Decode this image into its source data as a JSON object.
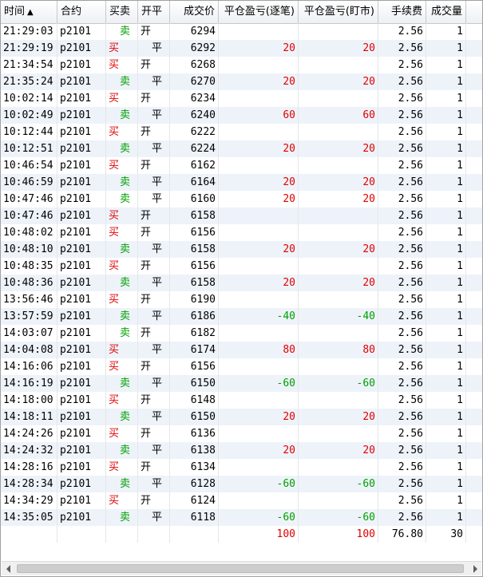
{
  "columns": [
    "时间",
    "合约",
    "买卖",
    "开平",
    "成交价",
    "平仓盈亏(逐笔)",
    "平仓盈亏(盯市)",
    "手续费",
    "成交量"
  ],
  "sort_indicator": "▲",
  "rows": [
    {
      "time": "21:29:03",
      "contract": "p2101",
      "side": "卖",
      "oc": "开",
      "price": "6294",
      "pnl1": "",
      "pnl2": "",
      "fee": "2.56",
      "qty": "1"
    },
    {
      "time": "21:29:19",
      "contract": "p2101",
      "side": "买",
      "oc": "平",
      "price": "6292",
      "pnl1": "20",
      "pnl2": "20",
      "fee": "2.56",
      "qty": "1"
    },
    {
      "time": "21:34:54",
      "contract": "p2101",
      "side": "买",
      "oc": "开",
      "price": "6268",
      "pnl1": "",
      "pnl2": "",
      "fee": "2.56",
      "qty": "1"
    },
    {
      "time": "21:35:24",
      "contract": "p2101",
      "side": "卖",
      "oc": "平",
      "price": "6270",
      "pnl1": "20",
      "pnl2": "20",
      "fee": "2.56",
      "qty": "1"
    },
    {
      "time": "10:02:14",
      "contract": "p2101",
      "side": "买",
      "oc": "开",
      "price": "6234",
      "pnl1": "",
      "pnl2": "",
      "fee": "2.56",
      "qty": "1"
    },
    {
      "time": "10:02:49",
      "contract": "p2101",
      "side": "卖",
      "oc": "平",
      "price": "6240",
      "pnl1": "60",
      "pnl2": "60",
      "fee": "2.56",
      "qty": "1"
    },
    {
      "time": "10:12:44",
      "contract": "p2101",
      "side": "买",
      "oc": "开",
      "price": "6222",
      "pnl1": "",
      "pnl2": "",
      "fee": "2.56",
      "qty": "1"
    },
    {
      "time": "10:12:51",
      "contract": "p2101",
      "side": "卖",
      "oc": "平",
      "price": "6224",
      "pnl1": "20",
      "pnl2": "20",
      "fee": "2.56",
      "qty": "1"
    },
    {
      "time": "10:46:54",
      "contract": "p2101",
      "side": "买",
      "oc": "开",
      "price": "6162",
      "pnl1": "",
      "pnl2": "",
      "fee": "2.56",
      "qty": "1"
    },
    {
      "time": "10:46:59",
      "contract": "p2101",
      "side": "卖",
      "oc": "平",
      "price": "6164",
      "pnl1": "20",
      "pnl2": "20",
      "fee": "2.56",
      "qty": "1"
    },
    {
      "time": "10:47:46",
      "contract": "p2101",
      "side": "卖",
      "oc": "平",
      "price": "6160",
      "pnl1": "20",
      "pnl2": "20",
      "fee": "2.56",
      "qty": "1"
    },
    {
      "time": "10:47:46",
      "contract": "p2101",
      "side": "买",
      "oc": "开",
      "price": "6158",
      "pnl1": "",
      "pnl2": "",
      "fee": "2.56",
      "qty": "1"
    },
    {
      "time": "10:48:02",
      "contract": "p2101",
      "side": "买",
      "oc": "开",
      "price": "6156",
      "pnl1": "",
      "pnl2": "",
      "fee": "2.56",
      "qty": "1"
    },
    {
      "time": "10:48:10",
      "contract": "p2101",
      "side": "卖",
      "oc": "平",
      "price": "6158",
      "pnl1": "20",
      "pnl2": "20",
      "fee": "2.56",
      "qty": "1"
    },
    {
      "time": "10:48:35",
      "contract": "p2101",
      "side": "买",
      "oc": "开",
      "price": "6156",
      "pnl1": "",
      "pnl2": "",
      "fee": "2.56",
      "qty": "1"
    },
    {
      "time": "10:48:36",
      "contract": "p2101",
      "side": "卖",
      "oc": "平",
      "price": "6158",
      "pnl1": "20",
      "pnl2": "20",
      "fee": "2.56",
      "qty": "1"
    },
    {
      "time": "13:56:46",
      "contract": "p2101",
      "side": "买",
      "oc": "开",
      "price": "6190",
      "pnl1": "",
      "pnl2": "",
      "fee": "2.56",
      "qty": "1"
    },
    {
      "time": "13:57:59",
      "contract": "p2101",
      "side": "卖",
      "oc": "平",
      "price": "6186",
      "pnl1": "-40",
      "pnl2": "-40",
      "fee": "2.56",
      "qty": "1"
    },
    {
      "time": "14:03:07",
      "contract": "p2101",
      "side": "卖",
      "oc": "开",
      "price": "6182",
      "pnl1": "",
      "pnl2": "",
      "fee": "2.56",
      "qty": "1"
    },
    {
      "time": "14:04:08",
      "contract": "p2101",
      "side": "买",
      "oc": "平",
      "price": "6174",
      "pnl1": "80",
      "pnl2": "80",
      "fee": "2.56",
      "qty": "1"
    },
    {
      "time": "14:16:06",
      "contract": "p2101",
      "side": "买",
      "oc": "开",
      "price": "6156",
      "pnl1": "",
      "pnl2": "",
      "fee": "2.56",
      "qty": "1"
    },
    {
      "time": "14:16:19",
      "contract": "p2101",
      "side": "卖",
      "oc": "平",
      "price": "6150",
      "pnl1": "-60",
      "pnl2": "-60",
      "fee": "2.56",
      "qty": "1"
    },
    {
      "time": "14:18:00",
      "contract": "p2101",
      "side": "买",
      "oc": "开",
      "price": "6148",
      "pnl1": "",
      "pnl2": "",
      "fee": "2.56",
      "qty": "1"
    },
    {
      "time": "14:18:11",
      "contract": "p2101",
      "side": "卖",
      "oc": "平",
      "price": "6150",
      "pnl1": "20",
      "pnl2": "20",
      "fee": "2.56",
      "qty": "1"
    },
    {
      "time": "14:24:26",
      "contract": "p2101",
      "side": "买",
      "oc": "开",
      "price": "6136",
      "pnl1": "",
      "pnl2": "",
      "fee": "2.56",
      "qty": "1"
    },
    {
      "time": "14:24:32",
      "contract": "p2101",
      "side": "卖",
      "oc": "平",
      "price": "6138",
      "pnl1": "20",
      "pnl2": "20",
      "fee": "2.56",
      "qty": "1"
    },
    {
      "time": "14:28:16",
      "contract": "p2101",
      "side": "买",
      "oc": "开",
      "price": "6134",
      "pnl1": "",
      "pnl2": "",
      "fee": "2.56",
      "qty": "1"
    },
    {
      "time": "14:28:34",
      "contract": "p2101",
      "side": "卖",
      "oc": "平",
      "price": "6128",
      "pnl1": "-60",
      "pnl2": "-60",
      "fee": "2.56",
      "qty": "1"
    },
    {
      "time": "14:34:29",
      "contract": "p2101",
      "side": "买",
      "oc": "开",
      "price": "6124",
      "pnl1": "",
      "pnl2": "",
      "fee": "2.56",
      "qty": "1"
    },
    {
      "time": "14:35:05",
      "contract": "p2101",
      "side": "卖",
      "oc": "平",
      "price": "6118",
      "pnl1": "-60",
      "pnl2": "-60",
      "fee": "2.56",
      "qty": "1"
    }
  ],
  "totals": {
    "pnl1": "100",
    "pnl2": "100",
    "fee": "76.80",
    "qty": "30"
  },
  "colors": {
    "buy": "#e00000",
    "sell": "#00a000",
    "row_alt": "#eef3fa"
  },
  "scrollbar": {
    "left_icon": "arrow-left-icon",
    "right_icon": "arrow-right-icon"
  }
}
